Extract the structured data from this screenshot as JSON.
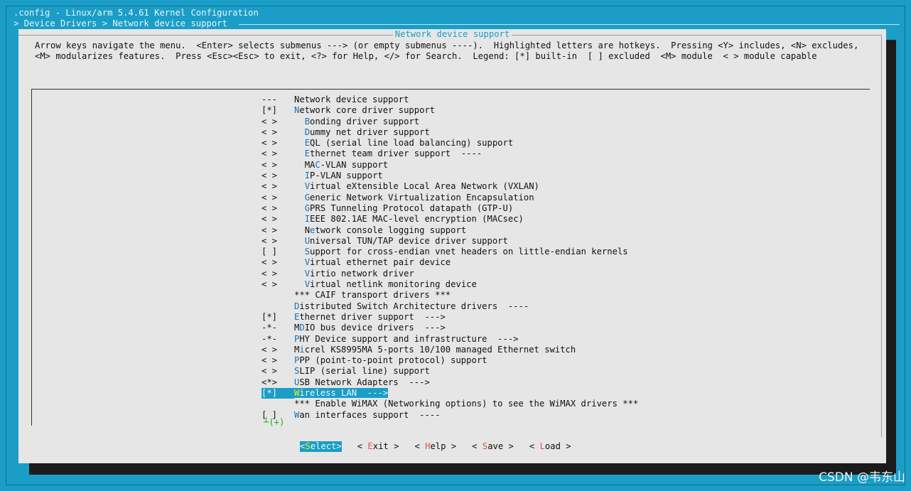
{
  "header": {
    "line1": ".config - Linux/arm 5.4.61 Kernel Configuration",
    "line2": "> Device Drivers > Network device support "
  },
  "dialog": {
    "title": "Network device support",
    "help": "Arrow keys navigate the menu.  <Enter> selects submenus ---> (or empty submenus ----).  Highlighted letters are hotkeys.  Pressing <Y> includes, <N> excludes, <M> modularizes features.  Press <Esc><Esc> to exit, <?> for Help, </> for Search.  Legend: [*] built-in  [ ] excluded  <M> module  < > module capable"
  },
  "menu": {
    "items": [
      {
        "mark": "---",
        "indent": "",
        "hot": "",
        "rest": "Network device support",
        "selected": false,
        "plain": true
      },
      {
        "mark": "[*]",
        "indent": "",
        "hot": "N",
        "rest": "etwork core driver support",
        "selected": false
      },
      {
        "mark": "< >",
        "indent": "  ",
        "hot": "B",
        "rest": "onding driver support",
        "selected": false
      },
      {
        "mark": "< >",
        "indent": "  ",
        "hot": "D",
        "rest": "ummy net driver support",
        "selected": false
      },
      {
        "mark": "< >",
        "indent": "  ",
        "hot": "E",
        "rest": "QL (serial line load balancing) support",
        "selected": false
      },
      {
        "mark": "< >",
        "indent": "  ",
        "hot": "E",
        "rest": "thernet team driver support  ----",
        "selected": false
      },
      {
        "mark": "< >",
        "indent": "  ",
        "pre": "MA",
        "hot": "C",
        "rest": "-VLAN support",
        "selected": false
      },
      {
        "mark": "< >",
        "indent": "  ",
        "hot": "I",
        "rest": "P-VLAN support",
        "selected": false
      },
      {
        "mark": "< >",
        "indent": "  ",
        "hot": "V",
        "rest": "irtual eXtensible Local Area Network (VXLAN)",
        "selected": false
      },
      {
        "mark": "< >",
        "indent": "  ",
        "hot": "G",
        "rest": "eneric Network Virtualization Encapsulation",
        "selected": false
      },
      {
        "mark": "< >",
        "indent": "  ",
        "hot": "G",
        "rest": "PRS Tunneling Protocol datapath (GTP-U)",
        "selected": false
      },
      {
        "mark": "< >",
        "indent": "  ",
        "hot": "I",
        "rest": "EEE 802.1AE MAC-level encryption (MACsec)",
        "selected": false
      },
      {
        "mark": "< >",
        "indent": "  ",
        "pre": "N",
        "hot": "e",
        "rest": "twork console logging support",
        "selected": false
      },
      {
        "mark": "< >",
        "indent": "  ",
        "hot": "U",
        "rest": "niversal TUN/TAP device driver support",
        "selected": false
      },
      {
        "mark": "[ ]",
        "indent": "  ",
        "hot": "S",
        "rest": "upport for cross-endian vnet headers on little-endian kernels",
        "selected": false
      },
      {
        "mark": "< >",
        "indent": "  ",
        "hot": "V",
        "rest": "irtual ethernet pair device",
        "selected": false
      },
      {
        "mark": "< >",
        "indent": "  ",
        "hot": "V",
        "rest": "irtio network driver",
        "selected": false
      },
      {
        "mark": "< >",
        "indent": "  ",
        "hot": "V",
        "rest": "irtual netlink monitoring device",
        "selected": false
      },
      {
        "mark": "",
        "indent": "",
        "hot": "",
        "rest": "*** CAIF transport drivers ***",
        "selected": false,
        "plain": true
      },
      {
        "mark": "",
        "indent": "",
        "hot": "D",
        "rest": "istributed Switch Architecture drivers  ----",
        "selected": false
      },
      {
        "mark": "[*]",
        "indent": "",
        "hot": "E",
        "rest": "thernet driver support  --->",
        "selected": false
      },
      {
        "mark": "-*-",
        "indent": "",
        "pre": "M",
        "hot": "D",
        "rest": "IO bus device drivers  --->",
        "selected": false
      },
      {
        "mark": "-*-",
        "indent": "",
        "hot": "P",
        "rest": "HY Device support and infrastructure  --->",
        "selected": false
      },
      {
        "mark": "< >",
        "indent": "",
        "pre": "M",
        "hot": "i",
        "rest": "crel KS8995MA 5-ports 10/100 managed Ethernet switch",
        "selected": false
      },
      {
        "mark": "< >",
        "indent": "",
        "hot": "P",
        "rest": "PP (point-to-point protocol) support",
        "selected": false
      },
      {
        "mark": "< >",
        "indent": "",
        "hot": "S",
        "rest": "LIP (serial line) support",
        "selected": false
      },
      {
        "mark": "<*>",
        "indent": "",
        "hot": "U",
        "rest": "SB Network Adapters  --->",
        "selected": false
      },
      {
        "mark": "[*]",
        "indent": "",
        "hot": "W",
        "rest": "ireless LAN  --->",
        "selected": true
      },
      {
        "mark": "",
        "indent": "",
        "hot": "",
        "rest": "*** Enable WiMAX (Networking options) to see the WiMAX drivers ***",
        "selected": false,
        "plain": true
      },
      {
        "mark": "[ ]",
        "indent": "",
        "hot": "W",
        "rest": "an interfaces support  ----",
        "selected": false
      }
    ],
    "more_indicator": "┴(+)"
  },
  "buttons": [
    {
      "pre": "<",
      "hk": "S",
      "post": "elect>",
      "active": true
    },
    {
      "pre": "< ",
      "hk": "E",
      "post": "xit >",
      "active": false
    },
    {
      "pre": "< ",
      "hk": "H",
      "post": "elp >",
      "active": false
    },
    {
      "pre": "< ",
      "hk": "S",
      "post": "ave >",
      "active": false
    },
    {
      "pre": "< ",
      "hk": "L",
      "post": "oad >",
      "active": false
    }
  ],
  "watermark": "CSDN @韦东山",
  "colors": {
    "background": "#1a9ec7",
    "dialog": "#e6e6e6",
    "hotkey": "#1a6fb0",
    "selected_hotkey": "#f0f000",
    "button_hotkey": "#e05050"
  }
}
